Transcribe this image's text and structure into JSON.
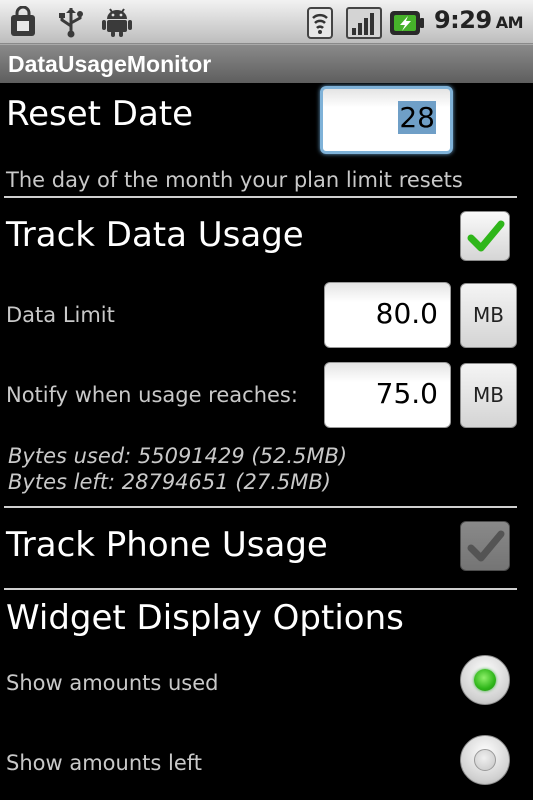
{
  "status_bar": {
    "time": "9:29",
    "ampm": "AM",
    "icons": [
      "shopping-bag-icon",
      "usb-icon",
      "android-icon",
      "wifi-icon",
      "signal-icon",
      "battery-charging-icon"
    ]
  },
  "app": {
    "title": "DataUsageMonitor"
  },
  "reset_date": {
    "label": "Reset Date",
    "value": "28",
    "description": "The day of the month your plan limit resets"
  },
  "track_data": {
    "label": "Track Data Usage",
    "checked": true
  },
  "data_limit": {
    "label": "Data Limit",
    "value": "80.0",
    "unit": "MB"
  },
  "notify": {
    "label": "Notify when usage reaches:",
    "value": "75.0",
    "unit": "MB"
  },
  "usage": {
    "bytes_used": "Bytes used: 55091429 (52.5MB)",
    "bytes_left": "Bytes left: 28794651 (27.5MB)"
  },
  "track_phone": {
    "label": "Track Phone Usage",
    "checked": true,
    "enabled": false
  },
  "widget": {
    "heading": "Widget Display Options",
    "options": [
      {
        "label": "Show amounts used",
        "selected": true
      },
      {
        "label": "Show amounts left",
        "selected": false
      }
    ]
  },
  "colors": {
    "background": "#000000",
    "check_green": "#2fb61a",
    "focus_blue": "#7fb2d8"
  }
}
